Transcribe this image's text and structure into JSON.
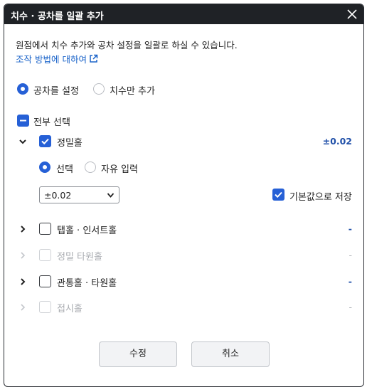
{
  "dialog": {
    "title": "치수 · 공차를 일괄 추가",
    "description": "원점에서 치수 추가와 공차 설정을 일괄로 하실 수 있습니다.",
    "help_link": "조작 방법에 대하여"
  },
  "mode": {
    "options": [
      {
        "label": "공차를 설정",
        "selected": true
      },
      {
        "label": "치수만 추가",
        "selected": false
      }
    ]
  },
  "select_all": {
    "label": "전부 선택",
    "state": "partial"
  },
  "items": [
    {
      "label": "정밀홀",
      "checked": true,
      "enabled": true,
      "expanded": true,
      "value": "±0.02"
    },
    {
      "label": "탭홀 · 인서트홀",
      "checked": false,
      "enabled": true,
      "expanded": false,
      "value": "-"
    },
    {
      "label": "정밀 타원홀",
      "checked": false,
      "enabled": false,
      "expanded": false,
      "value": "-"
    },
    {
      "label": "관통홀 · 타원홀",
      "checked": false,
      "enabled": true,
      "expanded": false,
      "value": "-"
    },
    {
      "label": "접시홀",
      "checked": false,
      "enabled": false,
      "expanded": false,
      "value": "-"
    }
  ],
  "detail": {
    "input_modes": [
      {
        "label": "선택",
        "selected": true
      },
      {
        "label": "자유 입력",
        "selected": false
      }
    ],
    "tolerance_select": "±0.02",
    "save_default": {
      "label": "기본값으로 저장",
      "checked": true
    }
  },
  "buttons": {
    "ok": "수정",
    "cancel": "취소"
  },
  "colors": {
    "accent": "#2660d6",
    "value_text": "#1f4fa8",
    "titlebar": "#1f2226",
    "link": "#1a63c9"
  }
}
